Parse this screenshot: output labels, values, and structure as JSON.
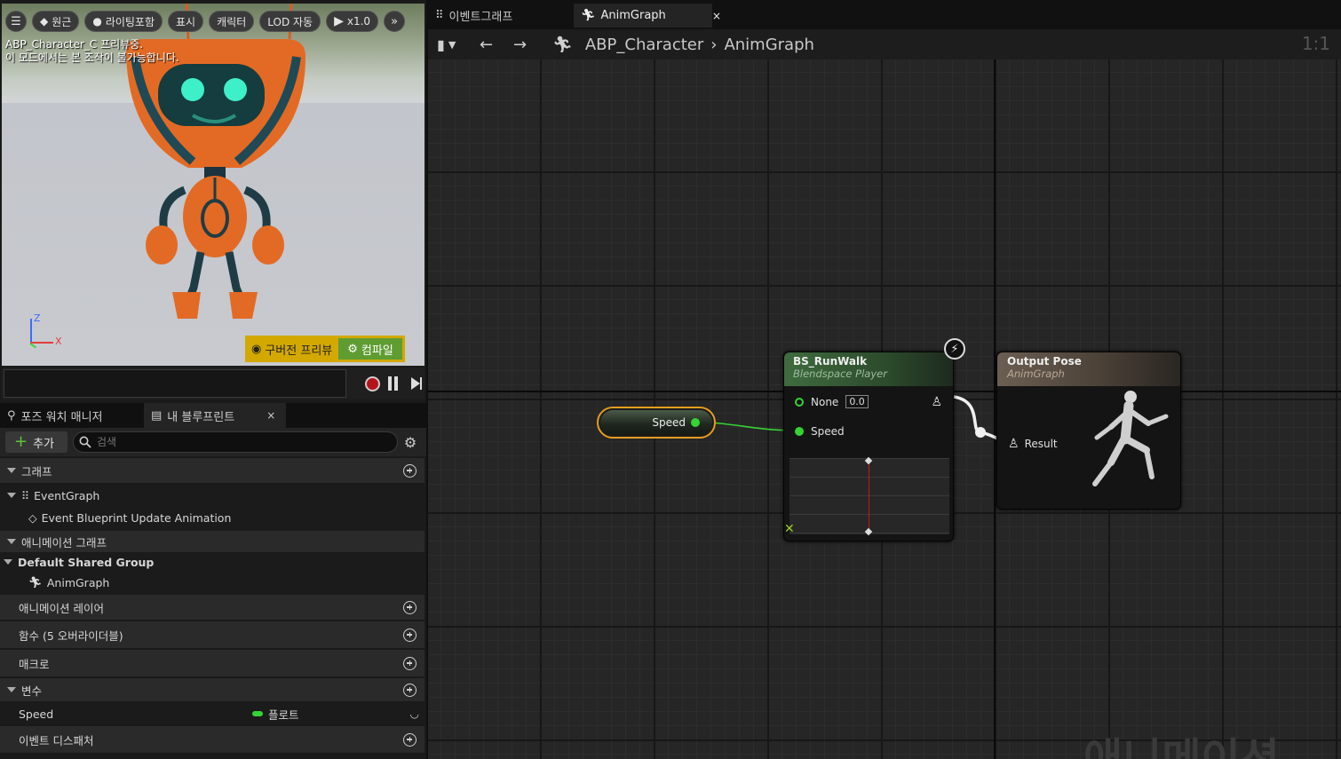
{
  "viewport": {
    "toolbar": {
      "menu_icon": "hamburger-icon",
      "perspective": "원근",
      "lighting": "라이팅포함",
      "show": "표시",
      "character": "캐릭터",
      "lod": "LOD 자동",
      "play_speed": "x1.0",
      "more_icon": "double-chevron-icon"
    },
    "info_line1": "ABP_Character_C 프리뷰중.",
    "info_line2": "이 모드에서는 본 조작이 불가능합니다.",
    "axis_z": "Z",
    "axis_x": "X",
    "prev_preview": "구버전 프리뷰",
    "compile": "컴파일"
  },
  "left_tabs": {
    "pose_watch": "포즈 워치 매니저",
    "my_blueprint": "내 블루프린트",
    "close": "×"
  },
  "my_blueprint": {
    "add_label": "추가",
    "search_placeholder": "검색",
    "tree": {
      "graphs": "그래프",
      "event_graph": "EventGraph",
      "event_update": "Event Blueprint Update Animation",
      "anim_graphs": "애니메이션 그래프",
      "default_group": "Default Shared Group",
      "anim_graph": "AnimGraph",
      "anim_layers": "애니메이션 레이어",
      "functions": "함수 (5 오버라이더블)",
      "macros": "매크로",
      "variables": "변수",
      "var_speed_name": "Speed",
      "var_speed_type": "플로트",
      "dispatchers": "이벤트 디스패처"
    }
  },
  "doc_tabs": {
    "event_graph": "이벤트그래프",
    "anim_graph": "AnimGraph",
    "close": "×"
  },
  "graph_bar": {
    "crumb_root": "ABP_Character",
    "crumb_leaf": "AnimGraph",
    "zoom": "1:1"
  },
  "graph": {
    "speed_node": {
      "label": "Speed"
    },
    "bs_node": {
      "title": "BS_RunWalk",
      "subtitle": "Blendspace Player",
      "pin_none": "None",
      "pin_none_value": "0.0",
      "pin_speed": "Speed"
    },
    "output_node": {
      "title": "Output Pose",
      "subtitle": "AnimGraph",
      "pin_result": "Result"
    },
    "watermark": "애니메이션"
  },
  "colors": {
    "float_pin": "#35d335",
    "selected_outline": "#e69c1e",
    "compile_green": "#5f9c32"
  }
}
